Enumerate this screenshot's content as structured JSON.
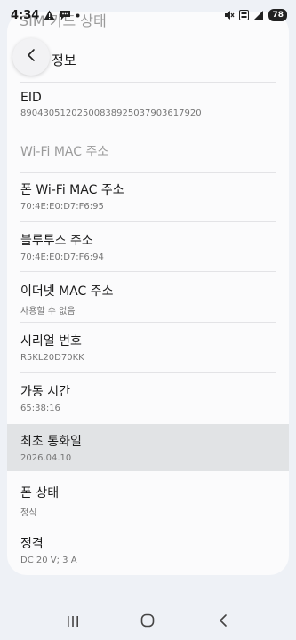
{
  "status_bar": {
    "time": "4:34",
    "battery": "78",
    "left_icons": [
      "warning-icon",
      "message-icon",
      "dot-icon"
    ],
    "right_icons": [
      "mute-icon",
      "volte-icon",
      "signal-icon",
      "battery-icon"
    ]
  },
  "header": {
    "peek_title": "SIM 카드 상태",
    "sub_title": "IMEI 정보"
  },
  "rows": [
    {
      "label": "EID",
      "value": "89043051202500838925037903617920",
      "disabled": false
    },
    {
      "label": "Wi-Fi MAC 주소",
      "value": "",
      "disabled": true
    },
    {
      "label": "폰 Wi-Fi MAC 주소",
      "value": "70:4E:E0:D7:F6:95",
      "disabled": false
    },
    {
      "label": "블루투스 주소",
      "value": "70:4E:E0:D7:F6:94",
      "disabled": false
    },
    {
      "label": "이더넷 MAC 주소",
      "value": "사용할 수 없음",
      "disabled": false
    },
    {
      "label": "시리얼 번호",
      "value": "R5KL20D70KK",
      "disabled": false
    },
    {
      "label": "가동 시간",
      "value": "65:38:16",
      "disabled": false
    },
    {
      "label": "최초 통화일",
      "value": "2026.04.10",
      "disabled": false,
      "highlight": true
    },
    {
      "label": "폰 상태",
      "value": "정식",
      "disabled": false
    },
    {
      "label": "정격",
      "value": "DC 20 V; 3 A",
      "disabled": false
    }
  ],
  "nav": [
    "recents-icon",
    "home-icon",
    "back-icon"
  ]
}
